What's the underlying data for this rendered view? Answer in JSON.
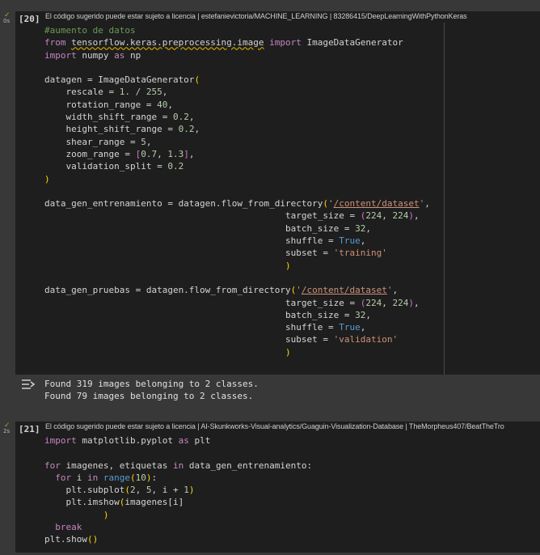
{
  "cells": [
    {
      "exec_count": "[20]",
      "run_time": "0s",
      "license_notice": "El código sugerido puede estar sujeto a licencia | estefanievictoria/MACHINE_LEARNING | 83286415/DeepLearningWithPythonKeras",
      "code": {
        "comment": "#aumento de datos",
        "kw_from": "from",
        "module": "tensorflow.keras.preprocessing.image",
        "kw_import": "import",
        "import_name": "ImageDataGenerator",
        "kw_import2": "import",
        "numpy": "numpy",
        "kw_as": "as",
        "np": "np",
        "datagen_assign": "datagen = ImageDataGenerator",
        "rescale": "rescale = ",
        "rescale_val": "1. / 255",
        "rotation": "rotation_range = ",
        "rotation_val": "40",
        "width": "width_shift_range = ",
        "width_val": "0.2",
        "height": "height_shift_range = ",
        "height_val": "0.2",
        "shear": "shear_range = ",
        "shear_val": "5",
        "zoom": "zoom_range = ",
        "zoom_a": "0.7",
        "zoom_b": "1.3",
        "validation": "validation_split = ",
        "validation_val": "0.2",
        "train_assign": "data_gen_entrenamiento = datagen.flow_from_directory",
        "dataset_path": "/content/dataset",
        "target_size": "target_size = ",
        "ts_a": "224",
        "ts_b": "224",
        "batch_size": "batch_size = ",
        "bs_val": "32",
        "shuffle": "shuffle = ",
        "true_val": "True",
        "subset": "subset = ",
        "subset_train": "'training'",
        "test_assign": "data_gen_pruebas = datagen.flow_from_directory",
        "subset_val": "'validation'"
      },
      "output_lines": [
        "Found 319 images belonging to 2 classes.",
        "Found 79 images belonging to 2 classes."
      ]
    },
    {
      "exec_count": "[21]",
      "run_time": "2s",
      "license_notice": "El código sugerido puede estar sujeto a licencia | AI-Skunkworks-Visual-analytics/Guaguin-Visualization-Database | TheMorpheus407/BeatTheTro",
      "code": {
        "kw_import": "import",
        "module": "matplotlib.pyplot",
        "kw_as": "as",
        "alias": "plt",
        "kw_for": "for",
        "loop_vars": " imagenes, etiquetas ",
        "kw_in": "in",
        "loop_iter": " data_gen_entrenamiento:",
        "kw_for2": "for",
        "i": " i ",
        "kw_in2": "in",
        "range_fn": "range",
        "range_val": "10",
        "subplot": "plt.subplot",
        "sub_a": "2",
        "sub_b": "5",
        "sub_c": "i + ",
        "sub_d": "1",
        "imshow": "plt.imshow",
        "imshow_arg": "imagenes[i]",
        "kw_break": "break",
        "show": "plt.show"
      }
    }
  ]
}
